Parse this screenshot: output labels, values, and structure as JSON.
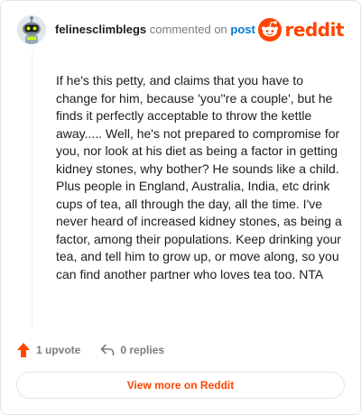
{
  "header": {
    "username": "felinesclimblegs",
    "action_text": "commented on",
    "post_link": "post",
    "brand": "reddit",
    "avatar_icon": "snoo-avatar-icon",
    "brand_icon": "reddit-logo-icon"
  },
  "comment": {
    "body": "If he's this petty, and claims that you have to change for him, because 'you''re a couple', but he finds it perfectly acceptable to throw the kettle away..... Well, he's not prepared to compromise for you, nor look at his diet as being a factor in getting kidney stones, why bother? He sounds like a child. Plus people in England, Australia, India, etc drink cups of tea, all through the day, all the time. I've never heard of increased kidney stones, as being a factor, among their populations. Keep drinking your tea, and tell him to grow up, or move along, so you can find another partner who loves tea too. NTA"
  },
  "actions": {
    "upvote_label": "1 upvote",
    "reply_label": "0 replies",
    "upvote_icon": "upvote-arrow-icon",
    "reply_icon": "reply-icon"
  },
  "footer": {
    "view_more_label": "View more on Reddit"
  },
  "colors": {
    "brand": "#ff4500",
    "link": "#0079d3",
    "muted": "#7c7c7c",
    "border": "#e3e6e8"
  }
}
